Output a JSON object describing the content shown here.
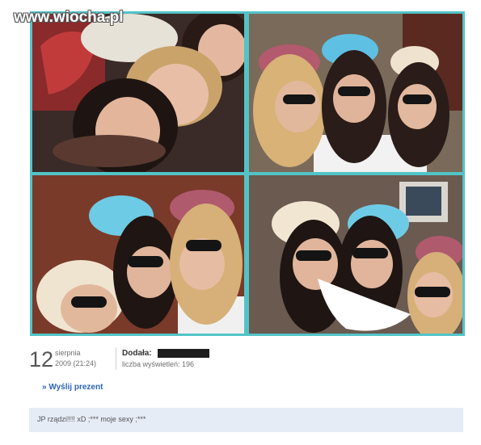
{
  "watermark": "www.wiocha.pl",
  "photos": [
    {
      "alt": "photo 1"
    },
    {
      "alt": "photo 2"
    },
    {
      "alt": "photo 3"
    },
    {
      "alt": "photo 4"
    }
  ],
  "post_info": {
    "day": "12",
    "month": "sierpnia",
    "year_time": "2009 (21:24)",
    "added_by_label": "Dodała:",
    "views_text": "liczba wyświetleń: 196"
  },
  "actions": {
    "send_gift": "» Wyślij prezent"
  },
  "comment": {
    "text": "JP rządzi!!!! xD ;*** moje sexy ;***"
  },
  "colors": {
    "collage_border": "#52c4c7",
    "link": "#2b64b8",
    "comment_bg": "#e6ecf6"
  }
}
